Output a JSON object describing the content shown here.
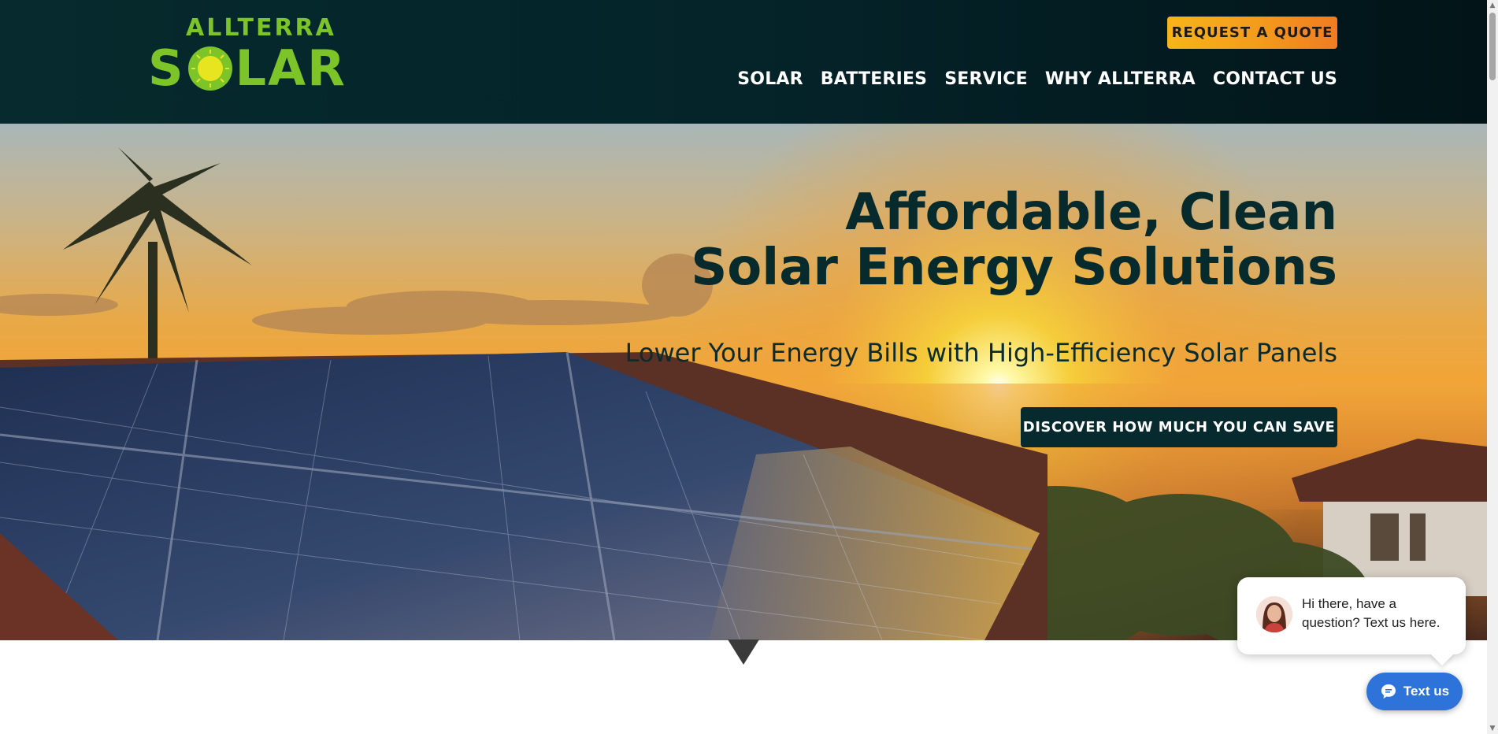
{
  "logo": {
    "top_text": "ALLTERRA",
    "s_letter": "S",
    "main_rest": "LAR"
  },
  "header": {
    "quote_button": "REQUEST A QUOTE",
    "nav": [
      "SOLAR",
      "BATTERIES",
      "SERVICE",
      "WHY ALLTERRA",
      "CONTACT US"
    ]
  },
  "hero": {
    "title_line1": "Affordable, Clean",
    "title_line2": "Solar Energy Solutions",
    "subtitle": "Lower Your Energy Bills with High-Efficiency Solar Panels",
    "cta": "DISCOVER HOW MUCH YOU CAN SAVE"
  },
  "chat": {
    "message": "Hi there, have a question? Text us here.",
    "button": "Text us",
    "icon": "chat-icon"
  },
  "colors": {
    "header_bg": "#062a2d",
    "brand_green": "#7cc427",
    "quote_orange": "#f49a1c",
    "chat_blue": "#2d73d9"
  }
}
